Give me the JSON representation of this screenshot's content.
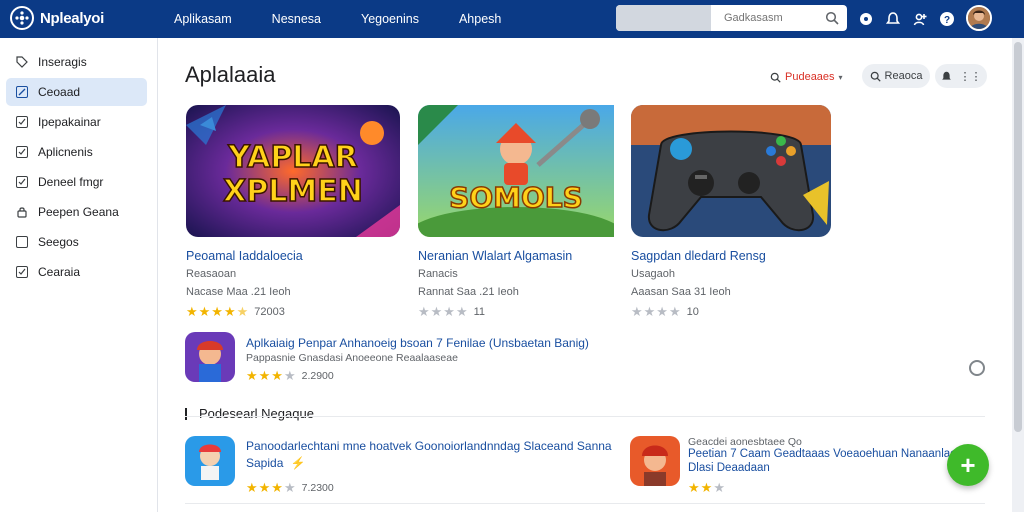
{
  "header": {
    "logo_text": "Nplealyoi",
    "nav": [
      "Aplikasam",
      "Nesnesa",
      "Yegoenins",
      "Ahpesh"
    ],
    "search_placeholder": "Gadkasasm"
  },
  "sidebar": {
    "items": [
      {
        "label": "Inseragis",
        "icon": "tag-icon",
        "active": false
      },
      {
        "label": "Ceoaad",
        "icon": "edit-icon",
        "active": true
      },
      {
        "label": "Ipepakainar",
        "icon": "check-icon",
        "active": false
      },
      {
        "label": "Aplicnenis",
        "icon": "check-icon",
        "active": false
      },
      {
        "label": "Deneel fmgr",
        "icon": "check-icon",
        "active": false
      },
      {
        "label": "Peepen Geana",
        "icon": "lock-icon",
        "active": false
      },
      {
        "label": "Seegos",
        "icon": "square-icon",
        "active": false
      },
      {
        "label": "Cearaia",
        "icon": "check-icon",
        "active": false
      }
    ]
  },
  "main": {
    "title": "Aplalaaia",
    "filters": {
      "primary": "Pudeaaes",
      "secondary": "Reaoca"
    },
    "cards": [
      {
        "art_text": "YAPLAR XPLMEN",
        "title": "Peoamal Iaddaloecia",
        "sub": "Reasaoan",
        "meta": "Nacase Maa .21 Ieoh",
        "stars": 4.5,
        "count": "72003"
      },
      {
        "art_text": "SOMOLS",
        "title": "Neranian Wlalart Algamasin",
        "sub": "Ranacis",
        "meta": "Rannat Saa .21 Ieoh",
        "stars": 2,
        "count": "11"
      },
      {
        "art_text": "",
        "title": "Sagpdan dledard Rensg",
        "sub": "Usagaoh",
        "meta": "Aaasan Saa 31 Ieoh",
        "stars": 2,
        "count": "10"
      }
    ],
    "featured": {
      "title": "Aplkaiaig Penpar Anhanoeig bsoan 7 Fenilae (Unsbaetan Banig)",
      "desc": "Pappasnie Gnasdasi Anoeeone Reaalaaseae",
      "stars": 4,
      "count": "2.2900"
    },
    "section_title": "Podesearl Negaque",
    "list": [
      {
        "title": "Panoodarlechtani mne hoatvek Goonoiorlandnndag Slaceand Sanna",
        "title2": "Sapida",
        "stars": 4,
        "count": "7.2300"
      },
      {
        "title": "Geacdei aonesbtaee Qo",
        "title2": "Peetian 7 Caam Geadtaaas Voeaoehuan Nanaanlaee",
        "title3": "Dlasi Deaadaan",
        "stars": 2,
        "count": ""
      }
    ]
  },
  "colors": {
    "topbar": "#0b3a86",
    "accent": "#1a4fa0",
    "fab": "#3fba2a",
    "star": "#f2b400"
  }
}
